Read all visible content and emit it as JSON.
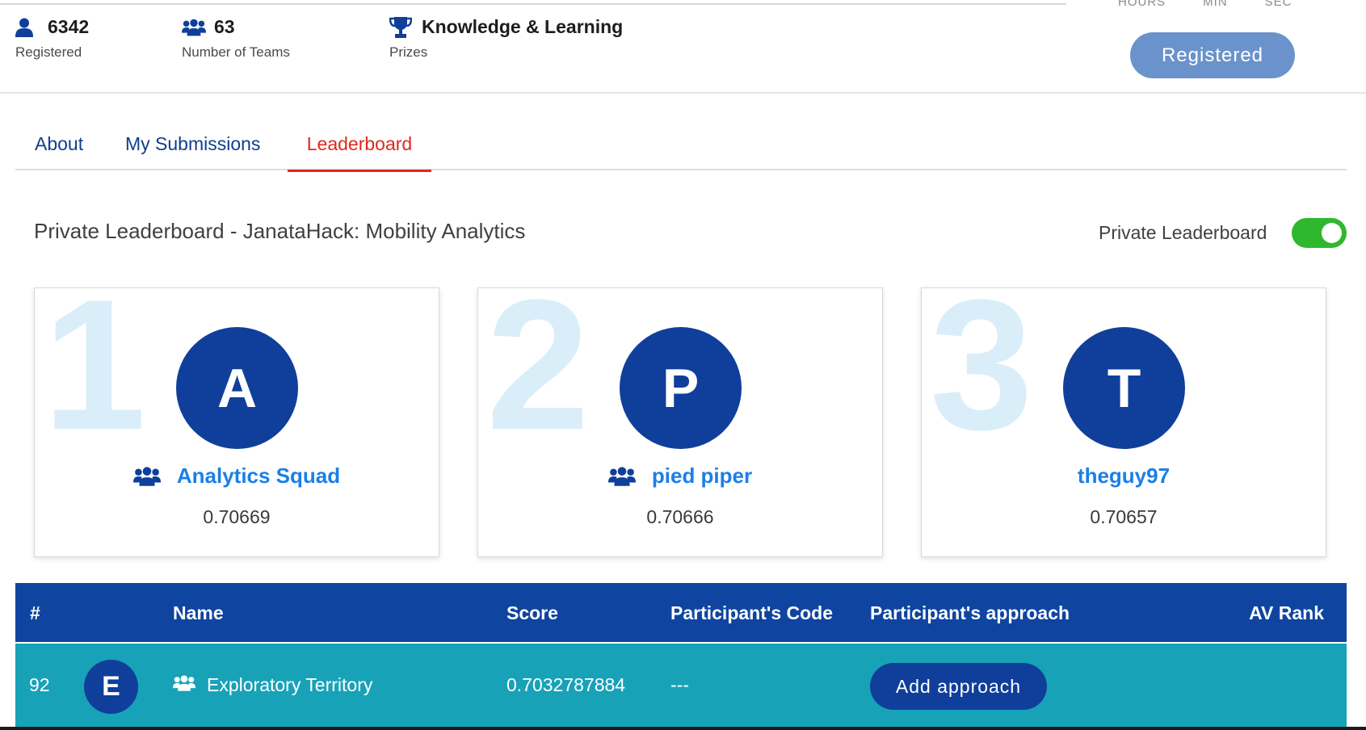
{
  "stats": {
    "registered": {
      "value": "6342",
      "label": "Registered",
      "icon": "user-icon"
    },
    "teams": {
      "value": "63",
      "label": "Number of Teams",
      "icon": "users-icon"
    },
    "prizes": {
      "value": "Knowledge & Learning",
      "label": "Prizes",
      "icon": "trophy-icon"
    }
  },
  "timer": {
    "labels": [
      "HOURS",
      "MIN",
      "SEC"
    ]
  },
  "registered_button": "Registered",
  "tabs": [
    {
      "label": "About",
      "active": false
    },
    {
      "label": "My Submissions",
      "active": false
    },
    {
      "label": "Leaderboard",
      "active": true
    }
  ],
  "leaderboard": {
    "title": "Private Leaderboard - JanataHack: Mobility Analytics",
    "toggle_label": "Private Leaderboard",
    "toggle_on": true
  },
  "podium": [
    {
      "rank": "1",
      "initial": "A",
      "name": "Analytics Squad",
      "score": "0.70669",
      "is_team": true
    },
    {
      "rank": "2",
      "initial": "P",
      "name": "pied piper",
      "score": "0.70666",
      "is_team": true
    },
    {
      "rank": "3",
      "initial": "T",
      "name": "theguy97",
      "score": "0.70657",
      "is_team": false
    }
  ],
  "table": {
    "headers": {
      "rank": "#",
      "name": "Name",
      "score": "Score",
      "code": "Participant's Code",
      "approach": "Participant's approach",
      "av_rank": "AV Rank"
    },
    "rows": [
      {
        "rank": "92",
        "initial": "E",
        "name": "Exploratory Territory",
        "score": "0.7032787884",
        "code": "---",
        "approach_button": "Add approach",
        "av_rank": ""
      }
    ]
  },
  "colors": {
    "navy": "#0f3f9a",
    "link_blue": "#1a7fe8",
    "active_tab": "#e0281c",
    "highlight_row": "#17a2b8",
    "toggle_on": "#2eb82e",
    "registered_btn": "#6b93cb"
  }
}
